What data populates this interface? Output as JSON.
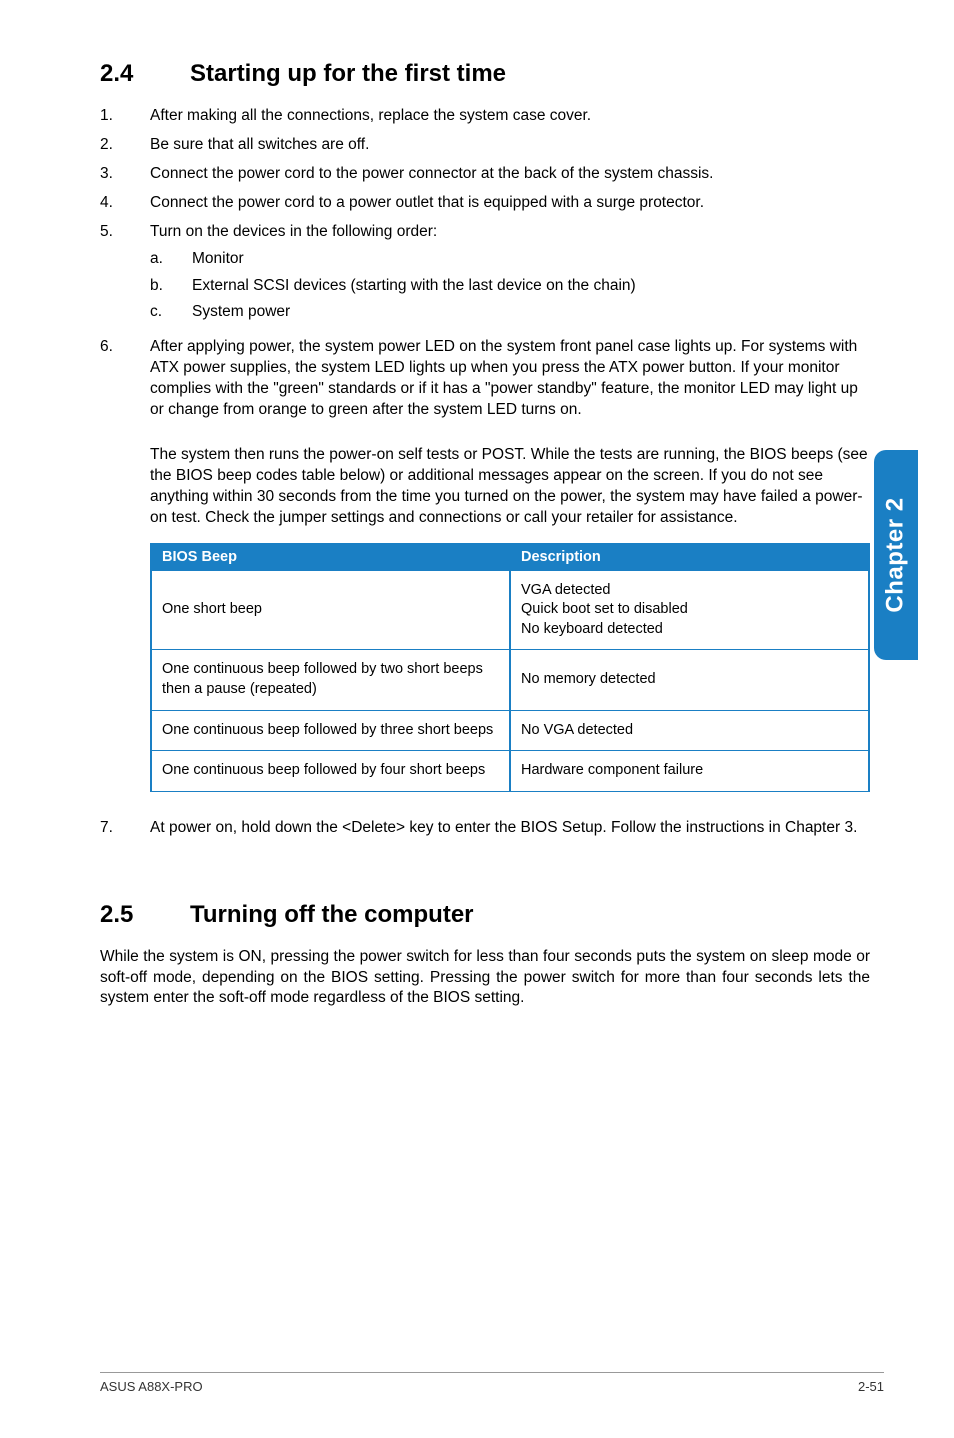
{
  "tab": {
    "label": "Chapter 2"
  },
  "section24": {
    "number": "2.4",
    "title": "Starting up for the first time",
    "list": [
      {
        "n": "1.",
        "text": "After making all the connections, replace the system case cover."
      },
      {
        "n": "2.",
        "text": "Be sure that all switches are off."
      },
      {
        "n": "3.",
        "text": "Connect the power cord to the power connector at the back of the system chassis."
      },
      {
        "n": "4.",
        "text": "Connect the power cord to a power outlet that is equipped with a surge protector."
      },
      {
        "n": "5.",
        "text": "Turn on the devices in the following order:",
        "sub": [
          {
            "sn": "a.",
            "text": "Monitor"
          },
          {
            "sn": "b.",
            "text": "External SCSI devices (starting with the last device on the chain)"
          },
          {
            "sn": "c.",
            "text": "System power"
          }
        ]
      },
      {
        "n": "6.",
        "text": "After applying power, the system power LED on the system front panel case lights up. For systems with ATX power supplies, the system LED lights up when you press the ATX power button. If your monitor complies with the \"green\" standards or if it has a \"power standby\" feature, the monitor LED may light up or change from orange to green after the system LED turns on."
      }
    ],
    "para6b": "The system then runs the power-on self tests or POST. While the tests are running, the BIOS beeps (see the BIOS beep codes table below) or additional messages appear on the screen. If you do not see anything within 30 seconds from the time you turned on the power, the system may have failed a power-on test. Check the jumper settings and connections or call your retailer for assistance.",
    "table": {
      "headers": {
        "c1": "BIOS Beep",
        "c2": "Description"
      },
      "rows": [
        {
          "c1": "One short beep",
          "c2": "VGA detected\nQuick boot set to disabled\nNo keyboard detected"
        },
        {
          "c1": "One continuous beep followed by two short beeps then a pause (repeated)",
          "c2": "No memory detected"
        },
        {
          "c1": "One continuous beep followed by three short beeps",
          "c2": "No VGA detected"
        },
        {
          "c1": "One continuous beep followed by four short beeps",
          "c2": "Hardware component failure"
        }
      ]
    },
    "item7": {
      "n": "7.",
      "text": "At power on, hold down the <Delete> key to enter the BIOS Setup. Follow the instructions in Chapter 3."
    }
  },
  "section25": {
    "number": "2.5",
    "title": "Turning off the computer",
    "body": "While the system is ON, pressing the power switch for less than four seconds puts the system on sleep mode or soft-off mode, depending on the BIOS setting. Pressing the power switch for more than four seconds lets the system enter the soft-off mode regardless of the BIOS setting."
  },
  "footer": {
    "left": "ASUS A88X-PRO",
    "right": "2-51"
  }
}
